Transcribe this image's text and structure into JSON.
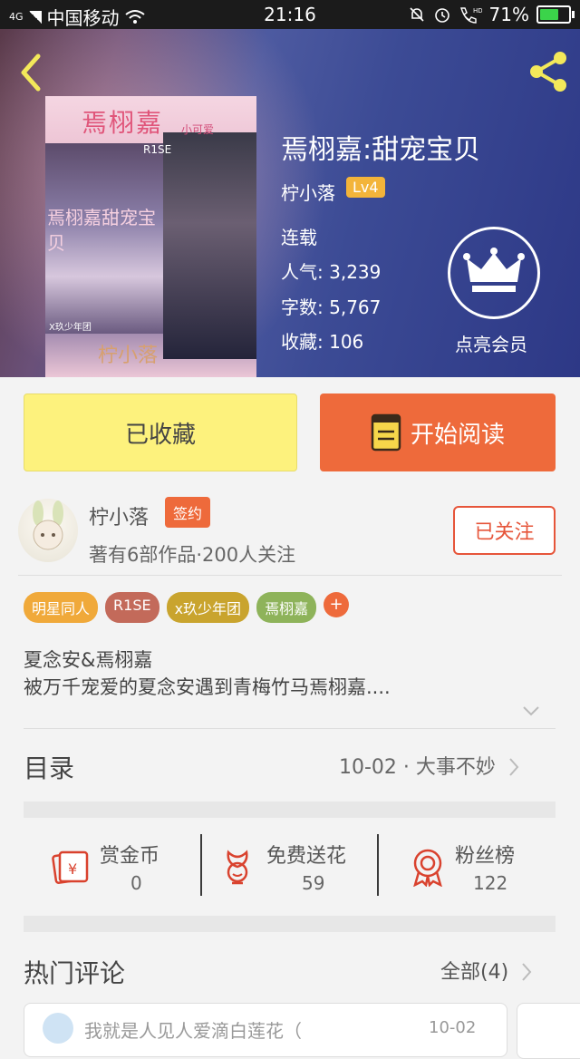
{
  "status_bar": {
    "carrier": "中国移动",
    "network": "4G",
    "time": "21:16",
    "battery": "71%",
    "battery_level": 0.71
  },
  "book": {
    "title": "焉栩嘉:甜宠宝贝",
    "author": "柠小落",
    "level": "Lv4",
    "status": "连载",
    "popularity_label": "人气:",
    "popularity": "3,239",
    "words_label": "字数:",
    "words": "5,767",
    "favorites_label": "收藏:",
    "favorites": "106",
    "vip_label": "点亮会员",
    "cover_text": {
      "title": "焉栩嘉",
      "cute": "小可爱",
      "band": "R1SE",
      "middle": "焉栩嘉甜宠宝贝",
      "credit": "X玖少年团",
      "author": "柠小落"
    }
  },
  "actions": {
    "favorited_label": "已收藏",
    "read_label": "开始阅读"
  },
  "author_card": {
    "name": "柠小落",
    "badge": "签约",
    "summary": "著有6部作品·200人关注",
    "follow_label": "已关注"
  },
  "tags": [
    {
      "label": "明星同人",
      "color": "#f0a93a"
    },
    {
      "label": "R1SE",
      "color": "#c36a5a"
    },
    {
      "label": "x玖少年团",
      "color": "#c9a42e"
    },
    {
      "label": "焉栩嘉",
      "color": "#8eb35a"
    }
  ],
  "tag_add": "+",
  "description": {
    "line1": "夏念安&焉栩嘉",
    "line2": "被万千宠爱的夏念安遇到青梅竹马焉栩嘉...."
  },
  "toc": {
    "label": "目录",
    "latest": "10-02 · 大事不妙"
  },
  "stats": [
    {
      "label": "赏金币",
      "value": "0",
      "icon": "red-envelope-icon"
    },
    {
      "label": "免费送花",
      "value": "59",
      "icon": "flower-icon"
    },
    {
      "label": "粉丝榜",
      "value": "122",
      "icon": "medal-icon"
    }
  ],
  "comments": {
    "label": "热门评论",
    "all_label": "全部(4)",
    "first": {
      "text": "我就是人见人爱滴白莲花（",
      "date": "10-02"
    }
  },
  "colors": {
    "accent": "#ee6a3b",
    "favorite_bg": "#fdf27d"
  }
}
